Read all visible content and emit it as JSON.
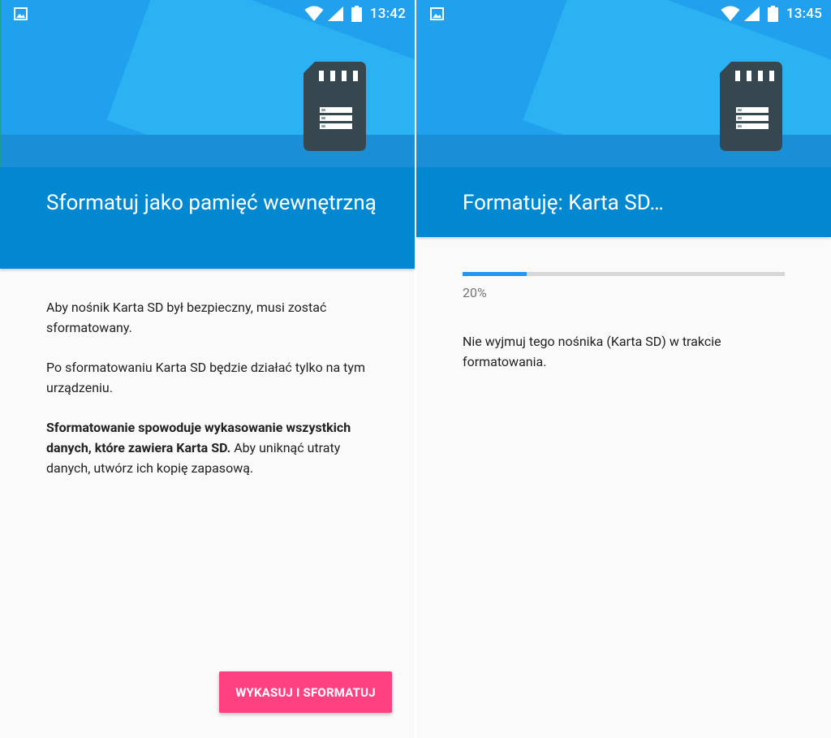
{
  "colors": {
    "hero_blue": "#21a0ed",
    "title_bar_blue": "#0288d1",
    "accent_pink": "#ff4081",
    "progress_blue": "#2196f3",
    "sd_card_icon": "#37474f"
  },
  "left": {
    "status_bar": {
      "time": "13:42",
      "icons": [
        "image-notification-icon",
        "wifi-icon",
        "signal-icon",
        "battery-icon"
      ]
    },
    "title": "Sformatuj jako pamięć wewnętrzną",
    "body": {
      "p1": "Aby nośnik Karta SD był bezpieczny, musi zostać sformatowany.",
      "p2": "Po sformatowaniu Karta SD będzie działać tylko na tym urządzeniu.",
      "p3_bold": "Sformatowanie spowoduje wykasowanie wszystkich danych, które zawiera Karta SD.",
      "p3_rest": " Aby uniknąć utraty danych, utwórz ich kopię zapasową."
    },
    "primary_button": "WYKASUJ I SFORMATUJ"
  },
  "right": {
    "status_bar": {
      "time": "13:45",
      "icons": [
        "image-notification-icon",
        "wifi-icon",
        "signal-icon",
        "battery-icon"
      ]
    },
    "title": "Formatuję: Karta SD…",
    "progress": {
      "value": 0.2,
      "label": "20%"
    },
    "message": "Nie wyjmuj tego nośnika (Karta SD) w trakcie formatowania."
  }
}
